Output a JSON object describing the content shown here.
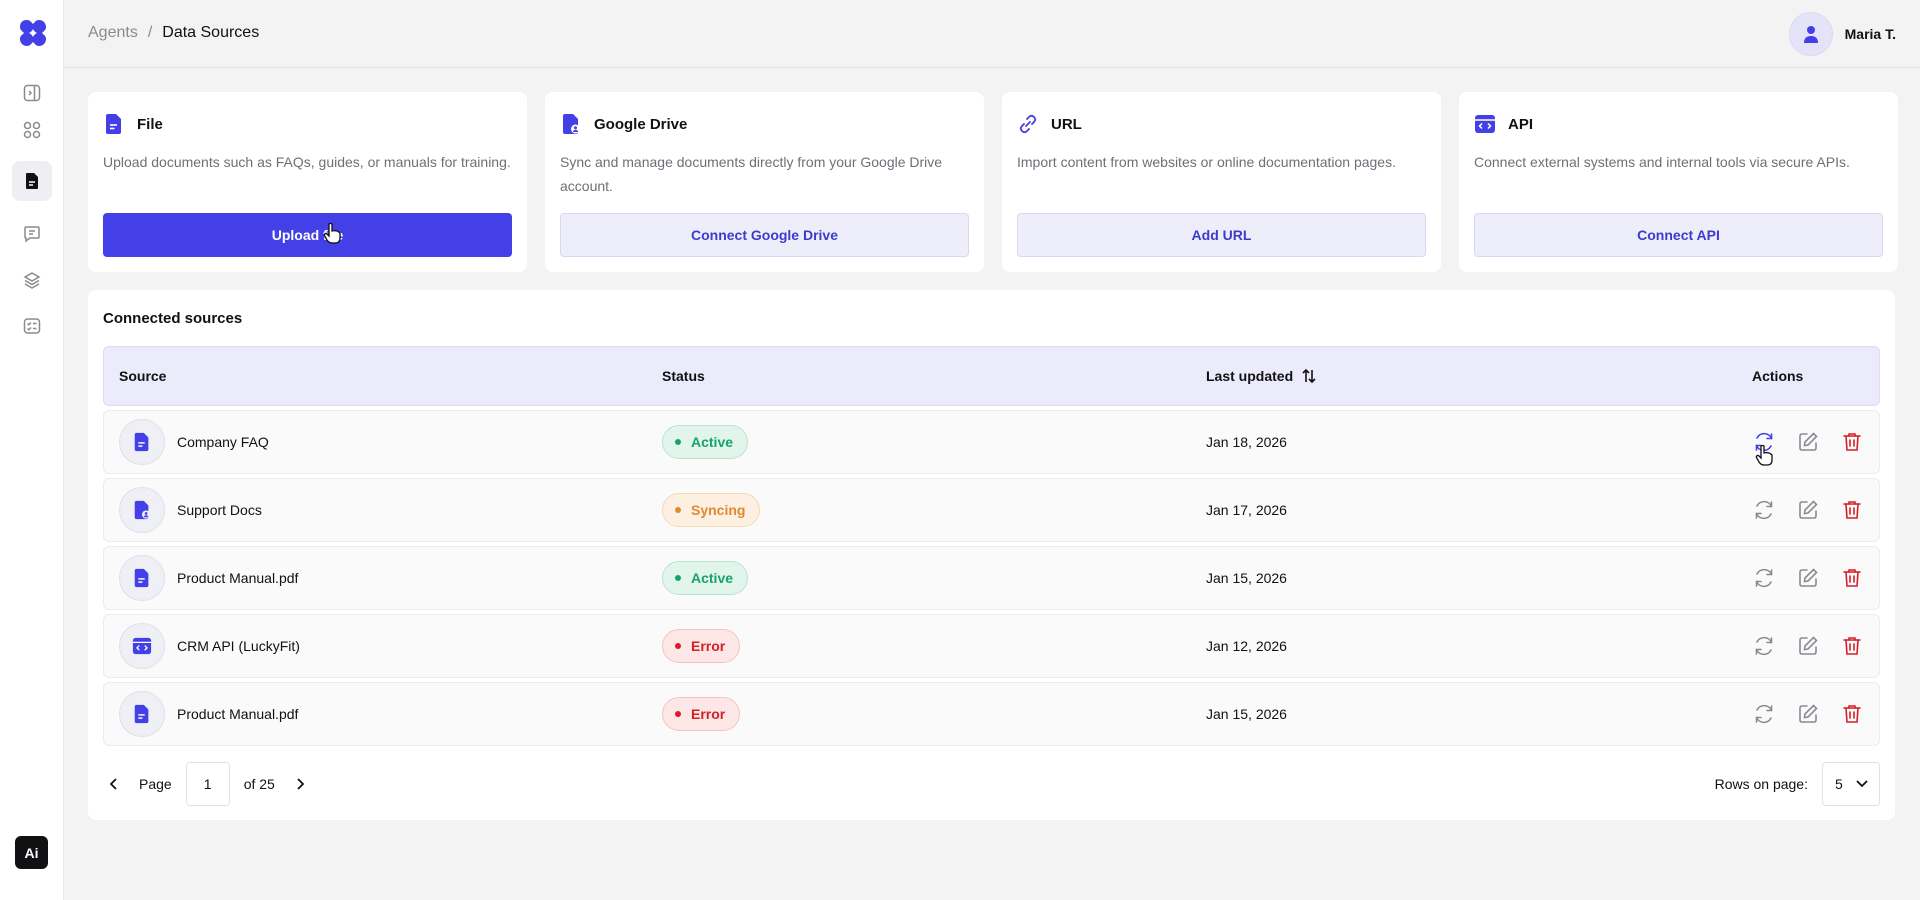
{
  "breadcrumb": {
    "parent": "Agents",
    "separator": "/",
    "current": "Data Sources"
  },
  "user": {
    "name": "Maria T."
  },
  "sidebar": {
    "ai_label": "Ai"
  },
  "cards": [
    {
      "title": "File",
      "description": "Upload documents such as FAQs, guides, or manuals for training.",
      "button": "Upload file",
      "icon": "file-icon"
    },
    {
      "title": "Google Drive",
      "description": "Sync and manage documents directly from your Google Drive account.",
      "button": "Connect Google Drive",
      "icon": "drive-icon"
    },
    {
      "title": "URL",
      "description": "Import content from websites or online documentation pages.",
      "button": "Add URL",
      "icon": "link-icon"
    },
    {
      "title": "API",
      "description": "Connect external systems and internal tools via secure APIs.",
      "button": "Connect API",
      "icon": "api-icon"
    }
  ],
  "connected": {
    "title": "Connected sources",
    "columns": {
      "source": "Source",
      "status": "Status",
      "updated": "Last updated",
      "actions": "Actions"
    },
    "rows": [
      {
        "name": "Company FAQ",
        "status": "Active",
        "date": "Jan 18, 2026",
        "icon": "file-icon"
      },
      {
        "name": "Support Docs",
        "status": "Syncing",
        "date": "Jan 17, 2026",
        "icon": "drive-icon"
      },
      {
        "name": "Product Manual.pdf",
        "status": "Active",
        "date": "Jan 15, 2026",
        "icon": "file-icon"
      },
      {
        "name": "CRM API (LuckyFit)",
        "status": "Error",
        "date": "Jan 12, 2026",
        "icon": "api-icon"
      },
      {
        "name": "Product Manual.pdf",
        "status": "Error",
        "date": "Jan 15, 2026",
        "icon": "file-icon"
      }
    ]
  },
  "pagination": {
    "page_label": "Page",
    "current": "1",
    "of_label": "of 25",
    "rows_label": "Rows on page:",
    "rows_value": "5"
  },
  "colors": {
    "accent": "#4240e6",
    "active": "#16a36a",
    "syncing": "#e08a2d",
    "error": "#d41f27"
  }
}
